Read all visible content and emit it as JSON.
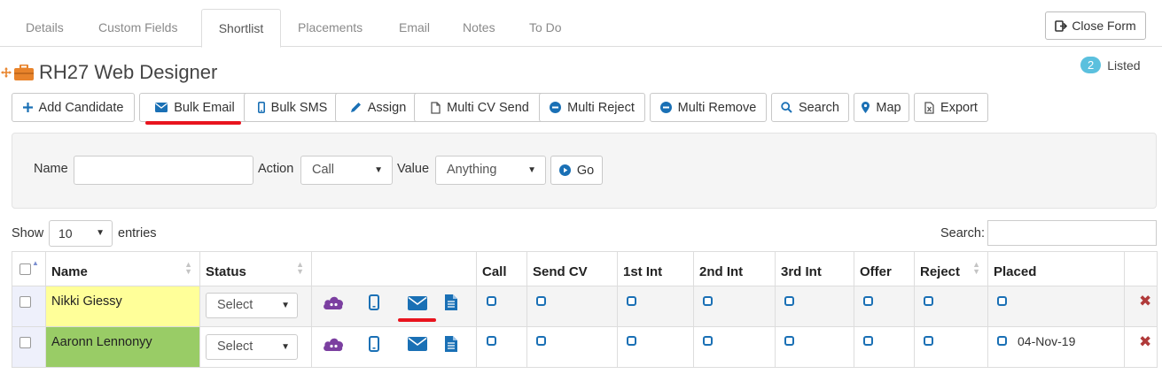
{
  "tabs": [
    "Details",
    "Custom Fields",
    "Shortlist",
    "Placements",
    "Email",
    "Notes",
    "To Do"
  ],
  "active_tab": "Shortlist",
  "close_form_label": "Close Form",
  "title": "RH27 Web Designer",
  "listed": {
    "count": "2",
    "label": "Listed"
  },
  "toolbar": {
    "add_candidate": "Add Candidate",
    "bulk_email": "Bulk Email",
    "bulk_sms": "Bulk SMS",
    "assign": "Assign",
    "multi_cv_send": "Multi CV Send",
    "multi_reject": "Multi Reject",
    "multi_remove": "Multi Remove",
    "search": "Search",
    "map": "Map",
    "export": "Export"
  },
  "filter": {
    "name_label": "Name",
    "action_label": "Action",
    "action_value": "Call",
    "value_label": "Value",
    "value_value": "Anything",
    "go_label": "Go"
  },
  "table_controls": {
    "show_label": "Show",
    "entries_value": "10",
    "entries_label": "entries",
    "search_label": "Search:"
  },
  "columns": [
    "Name",
    "Status",
    "",
    "Call",
    "Send CV",
    "1st Int",
    "2nd Int",
    "3rd Int",
    "Offer",
    "Reject",
    "Placed"
  ],
  "rows": [
    {
      "name": "Nikki Giessy",
      "status": "Select",
      "placed_date": ""
    },
    {
      "name": "Aaronn Lennonyy",
      "status": "Select",
      "placed_date": "04-Nov-19"
    }
  ],
  "colors": {
    "accent_blue": "#1a70b5",
    "highlight_red": "#e8141e",
    "row1_name_bg": "#ffff99",
    "row2_name_bg": "#99cc66",
    "briefcase_orange": "#e8832b",
    "cloud_purple": "#7b3fa0"
  }
}
